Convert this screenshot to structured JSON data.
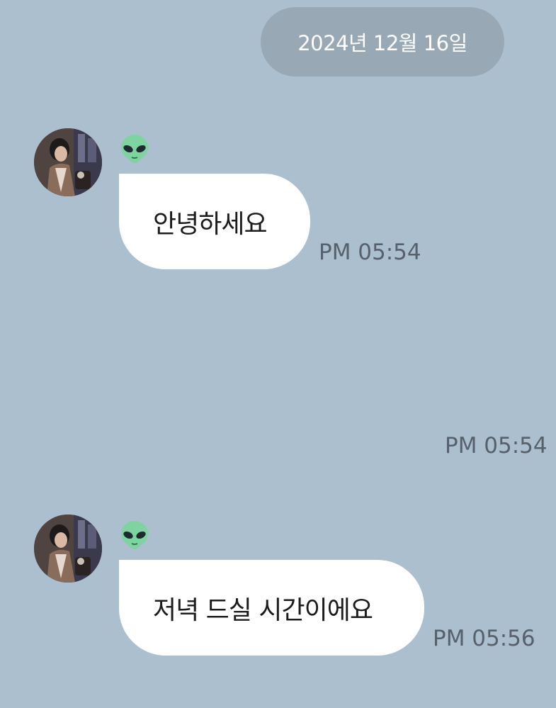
{
  "date_divider": "2024년 12월 16일",
  "messages": [
    {
      "sender_name": "👽",
      "text": "안녕하세요",
      "time": "PM 05:54"
    },
    {
      "time": "PM 05:54"
    },
    {
      "sender_name": "👽",
      "text": "저녁 드실 시간이에요",
      "time": "PM 05:56"
    }
  ],
  "colors": {
    "background": "#acbfcf",
    "date_pill": "#98a8b5",
    "bubble": "#ffffff",
    "time_text": "#56616b"
  },
  "icons": {
    "sender_name_icon": "alien-emoji-icon",
    "avatar": "profile-photo"
  }
}
